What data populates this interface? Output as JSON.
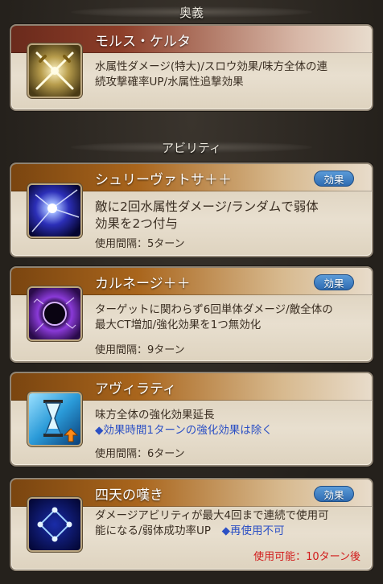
{
  "ougi_header": "奥義",
  "ability_header": "アビリティ",
  "ougi": {
    "name": "モルス・ケルタ",
    "desc_line1": "水属性ダメージ(特大)/スロウ効果/味方全体の連",
    "desc_line2": "続攻撃確率UP/水属性追撃効果",
    "icon": "crossed-swords-icon"
  },
  "abilities": [
    {
      "name": "シュリーヴァトサ＋＋",
      "badge": "効果",
      "desc_line1": "敵に2回水属性ダメージ/ランダムで弱体",
      "desc_line2": "効果を2つ付与",
      "cooldown": "使用間隔：5ターン",
      "icon": "starburst-icon"
    },
    {
      "name": "カルネージ＋＋",
      "badge": "効果",
      "desc_line1": "ターゲットに関わらず6回単体ダメージ/敵全体の",
      "desc_line2": "最大CT増加/強化効果を1つ無効化",
      "cooldown": "使用間隔：9ターン",
      "icon": "dark-orb-icon"
    },
    {
      "name": "アヴィラティ",
      "desc_line1": "味方全体の強化効果延長",
      "desc_line2": "◆効果時間1ターンの強化効果は除く",
      "cooldown": "使用間隔：6ターン",
      "icon": "hourglass-icon"
    },
    {
      "name": "四天の嘆き",
      "badge": "効果",
      "desc_line1": "ダメージアビリティが最大4回まで連続で使用可",
      "desc_line2a": "能になる/弱体成功率UP　",
      "desc_line2b": "◆再使用不可",
      "available": "使用可能：10ターン後",
      "icon": "diamond-nodes-icon"
    }
  ],
  "colors": {
    "card_bg": "#e8dfcf",
    "ougi_band": "#8c3d28",
    "ability_band": "#a9651c",
    "badge": "#2f6cb2",
    "note_blue": "#2c50c4",
    "available_red": "#d11a1a"
  }
}
